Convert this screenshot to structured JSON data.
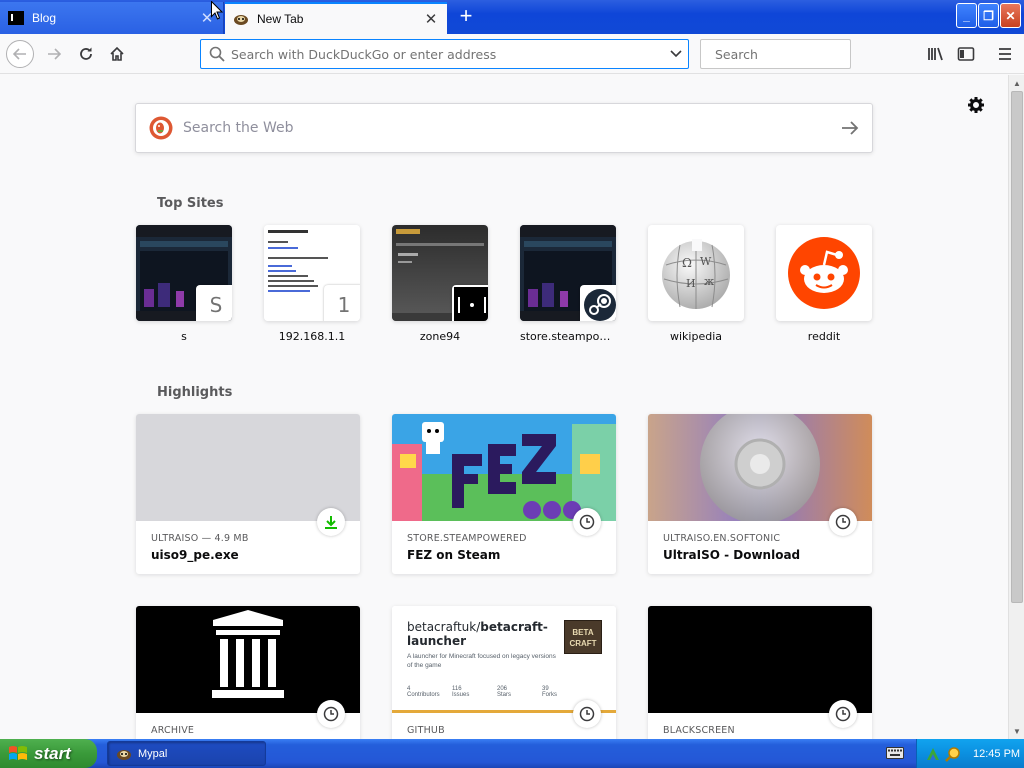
{
  "tabs": [
    {
      "title": "Blog",
      "active": false,
      "favicon": "terminal-icon"
    },
    {
      "title": "New Tab",
      "active": true,
      "favicon": "mypal-icon"
    }
  ],
  "navbar": {
    "url_placeholder": "Search with DuckDuckGo or enter address",
    "search_placeholder": "Search"
  },
  "content": {
    "web_search_placeholder": "Search the Web",
    "topsites_title": "Top Sites",
    "highlights_title": "Highlights",
    "topsites": [
      {
        "label": "s",
        "badge": "S"
      },
      {
        "label": "192.168.1.1",
        "badge": "1"
      },
      {
        "label": "zone94",
        "badge": ""
      },
      {
        "label": "store.steampowe...",
        "badge": ""
      },
      {
        "label": "wikipedia",
        "badge": ""
      },
      {
        "label": "reddit",
        "badge": ""
      }
    ],
    "highlights": [
      {
        "source": "ULTRAISO — 4.9 MB",
        "title": "uiso9_pe.exe",
        "icon": "download-icon"
      },
      {
        "source": "STORE.STEAMPOWERED",
        "title": "FEZ on Steam",
        "icon": "clock-icon"
      },
      {
        "source": "ULTRAISO.EN.SOFTONIC",
        "title": "UltraISO - Download",
        "icon": "clock-icon"
      },
      {
        "source": "ARCHIVE",
        "title": "",
        "icon": "clock-icon"
      },
      {
        "source": "GITHUB",
        "title": "",
        "icon": "clock-icon"
      },
      {
        "source": "BLACKSCREEN",
        "title": "",
        "icon": "clock-icon"
      }
    ],
    "github_preview": {
      "repo_owner": "betacraftuk/",
      "repo_name_1": "betacraft-",
      "repo_name_2": "launcher",
      "description": "A launcher for Minecraft focused on legacy versions of the game",
      "stats": [
        "4",
        "116",
        "206",
        "39"
      ],
      "stat_labels": [
        "Contributors",
        "Issues",
        "Stars",
        "Forks"
      ],
      "logo_line1": "BETA",
      "logo_line2": "CRAFT"
    }
  },
  "taskbar": {
    "start_label": "start",
    "task_label": "Mypal",
    "clock": "12:45 PM"
  },
  "colors": {
    "accent": "#0a84ff",
    "reddit": "#ff4500",
    "download_green": "#12bc00"
  }
}
